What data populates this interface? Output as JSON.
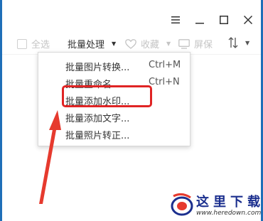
{
  "window_controls": {
    "menu_icon": "hamburger-icon",
    "minimize_icon": "minimize-icon",
    "maximize_icon": "maximize-icon",
    "close_icon": "close-icon"
  },
  "toolbar": {
    "select_all_label": "全选",
    "batch_label": "批量处理",
    "favorite_label": "收藏",
    "wallpaper_label": "屏保"
  },
  "menu": {
    "items": [
      {
        "label": "批量图片转换...",
        "shortcut": "Ctrl+M"
      },
      {
        "label": "批量重命名...",
        "shortcut": "Ctrl+N"
      },
      {
        "label": "批量添加水印...",
        "shortcut": ""
      },
      {
        "label": "批量添加文字...",
        "shortcut": ""
      },
      {
        "label": "批量照片转正...",
        "shortcut": ""
      }
    ]
  },
  "watermark": {
    "title": "这里下载",
    "url": "www.heredown.com"
  },
  "colors": {
    "frame": "#1f6fb8",
    "highlight": "#e02424",
    "arrow": "#e63a2e",
    "brand": "#1b2f8e"
  }
}
